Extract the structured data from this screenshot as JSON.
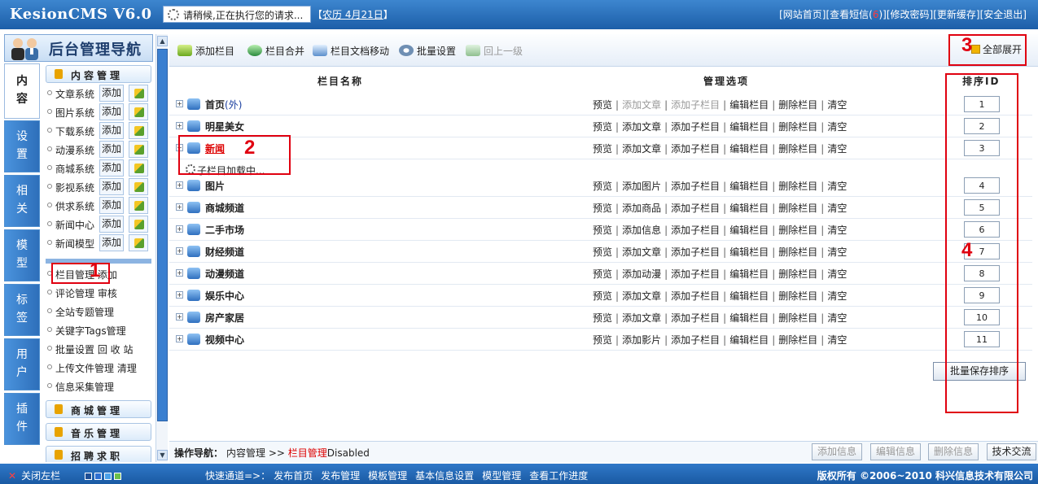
{
  "header": {
    "logo": "KesionCMS V6.0",
    "loading_text": "请稍候,正在执行您的请求...",
    "lunar_prefix": "【",
    "lunar_link": "农历 4月21日",
    "lunar_suffix": "】",
    "links": {
      "site_home": "[网站首页]",
      "messages_pre": "[查看短信(",
      "messages_count": "6",
      "messages_post": ")]",
      "change_password": "[修改密码]",
      "update_cache": "[更新缓存]",
      "logout": "[安全退出]"
    }
  },
  "sidebar": {
    "title": "后台管理导航",
    "tabs": [
      {
        "label1": "内",
        "label2": "容"
      },
      {
        "label1": "设",
        "label2": "置"
      },
      {
        "label1": "相",
        "label2": "关"
      },
      {
        "label1": "模",
        "label2": "型"
      },
      {
        "label1": "标",
        "label2": "签"
      },
      {
        "label1": "用",
        "label2": "户"
      },
      {
        "label1": "插",
        "label2": "件"
      }
    ],
    "group_content": "内容管理",
    "systems": [
      {
        "name": "文章系统"
      },
      {
        "name": "图片系统"
      },
      {
        "name": "下载系统"
      },
      {
        "name": "动漫系统"
      },
      {
        "name": "商城系统"
      },
      {
        "name": "影视系统"
      },
      {
        "name": "供求系统"
      },
      {
        "name": "新闻中心"
      },
      {
        "name": "新闻模型"
      }
    ],
    "add_label": "添加",
    "funcs": {
      "column_manage": "栏目管理",
      "column_add": "添加",
      "comment_manage": "评论管理",
      "comment_audit": "审核",
      "special": "全站专题管理",
      "tags": "关键字Tags管理",
      "batch": "批量设置",
      "recycle": "回 收 站",
      "upload": "上传文件管理",
      "clean": "清理",
      "collect": "信息采集管理"
    },
    "group_shop": "商城管理",
    "group_music": "音乐管理",
    "group_job": "招聘求职"
  },
  "toolbar": {
    "add_column": "添加栏目",
    "merge_column": "栏目合并",
    "move_docs": "栏目文档移动",
    "batch_settings": "批量设置",
    "up_level": "回上一级",
    "expand_all": "全部展开"
  },
  "table": {
    "col_name": "栏目名称",
    "col_ops": "管理选项",
    "col_sort": "排序ID",
    "rows": [
      {
        "name": "首页",
        "suffix": "(外)",
        "sort": "1",
        "ops": [
          "预览",
          "添加文章",
          "添加子栏目",
          "编辑栏目",
          "删除栏目",
          "清空"
        ]
      },
      {
        "name": "明星美女",
        "suffix": "",
        "sort": "2",
        "ops": [
          "预览",
          "添加文章",
          "添加子栏目",
          "编辑栏目",
          "删除栏目",
          "清空"
        ]
      },
      {
        "name": "新闻",
        "suffix": "",
        "sort": "3",
        "ops": [
          "预览",
          "添加文章",
          "添加子栏目",
          "编辑栏目",
          "删除栏目",
          "清空"
        ]
      },
      {
        "name": "图片",
        "suffix": "",
        "sort": "4",
        "ops": [
          "预览",
          "添加图片",
          "添加子栏目",
          "编辑栏目",
          "删除栏目",
          "清空"
        ]
      },
      {
        "name": "商城频道",
        "suffix": "",
        "sort": "5",
        "ops": [
          "预览",
          "添加商品",
          "添加子栏目",
          "编辑栏目",
          "删除栏目",
          "清空"
        ]
      },
      {
        "name": "二手市场",
        "suffix": "",
        "sort": "6",
        "ops": [
          "预览",
          "添加信息",
          "添加子栏目",
          "编辑栏目",
          "删除栏目",
          "清空"
        ]
      },
      {
        "name": "财经频道",
        "suffix": "",
        "sort": "7",
        "ops": [
          "预览",
          "添加文章",
          "添加子栏目",
          "编辑栏目",
          "删除栏目",
          "清空"
        ]
      },
      {
        "name": "动漫频道",
        "suffix": "",
        "sort": "8",
        "ops": [
          "预览",
          "添加动漫",
          "添加子栏目",
          "编辑栏目",
          "删除栏目",
          "清空"
        ]
      },
      {
        "name": "娱乐中心",
        "suffix": "",
        "sort": "9",
        "ops": [
          "预览",
          "添加文章",
          "添加子栏目",
          "编辑栏目",
          "删除栏目",
          "清空"
        ]
      },
      {
        "name": "房产家居",
        "suffix": "",
        "sort": "10",
        "ops": [
          "预览",
          "添加文章",
          "添加子栏目",
          "编辑栏目",
          "删除栏目",
          "清空"
        ]
      },
      {
        "name": "视频中心",
        "suffix": "",
        "sort": "11",
        "ops": [
          "预览",
          "添加影片",
          "添加子栏目",
          "编辑栏目",
          "删除栏目",
          "清空"
        ]
      }
    ],
    "sub_loading": "子栏目加载中...",
    "save_sort": "批量保存排序"
  },
  "annotations": {
    "n1": "1",
    "n2": "2",
    "n3": "3",
    "n4": "4"
  },
  "opbar": {
    "label": "操作导航：",
    "crumb_root": "内容管理",
    "crumb_sep": ">>",
    "crumb_current": "栏目管理",
    "crumb_tail": "Disabled",
    "btn_add": "添加信息",
    "btn_edit": "编辑信息",
    "btn_delete": "删除信息",
    "btn_support": "技术交流"
  },
  "footer": {
    "close_left": "关闭左栏",
    "quick_label": "快速通道=>：",
    "quick_links": [
      "发布首页",
      "发布管理",
      "模板管理",
      "基本信息设置",
      "模型管理",
      "查看工作进度"
    ],
    "copyright": "版权所有 ©2006~2010 科兴信息技术有限公司"
  },
  "colors": {
    "header_blue": "#1c5ea8",
    "annotation_red": "#e00010",
    "current_crumb": "#dd0000"
  }
}
